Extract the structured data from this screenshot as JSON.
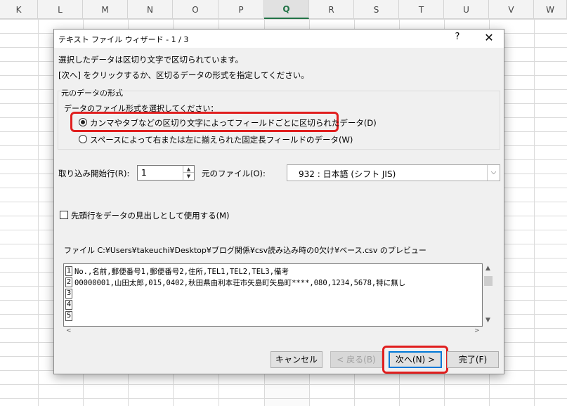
{
  "spreadsheet": {
    "columns": [
      "K",
      "L",
      "M",
      "N",
      "O",
      "P",
      "Q",
      "R",
      "S",
      "T",
      "U",
      "V",
      "W"
    ],
    "selected_column": "Q"
  },
  "dialog": {
    "title": "テキスト ファイル ウィザード - 1 / 3",
    "help_label": "?",
    "close_label": "✕",
    "intro_line1": "選択したデータは区切り文字で区切られています。",
    "intro_line2": "[次へ] をクリックするか、区切るデータの形式を指定してください。",
    "format_group": {
      "label": "元のデータの形式",
      "sublabel": "データのファイル形式を選択してください：",
      "options": [
        {
          "label": "カンマやタブなどの区切り文字によってフィールドごとに区切られたデータ(D)",
          "selected": true
        },
        {
          "label": "スペースによって右または左に揃えられた固定長フィールドのデータ(W)",
          "selected": false
        }
      ]
    },
    "start_row": {
      "label": "取り込み開始行(R):",
      "value": "1"
    },
    "origin": {
      "label": "元のファイル(O):",
      "value": "932 : 日本語 (シフト JIS)"
    },
    "header_checkbox": {
      "label": "先頭行をデータの見出しとして使用する(M)",
      "checked": false
    },
    "preview": {
      "caption": "ファイル C:¥Users¥takeuchi¥Desktop¥ブログ関係¥csv読み込み時の0欠け¥ベース.csv のプレビュー",
      "line_numbers": [
        "1",
        "2",
        "3",
        "4",
        "5"
      ],
      "rows": [
        "No.,名前,郵便番号1,郵便番号2,住所,TEL1,TEL2,TEL3,備考",
        "00000001,山田太郎,015,0402,秋田県由利本荘市矢島町矢島町****,080,1234,5678,特に無し",
        "",
        "",
        ""
      ]
    },
    "buttons": {
      "cancel": "キャンセル",
      "back": "< 戻る(B)",
      "next": "次へ(N) >",
      "finish": "完了(F)"
    },
    "highlight_color": "#e01e1e"
  }
}
